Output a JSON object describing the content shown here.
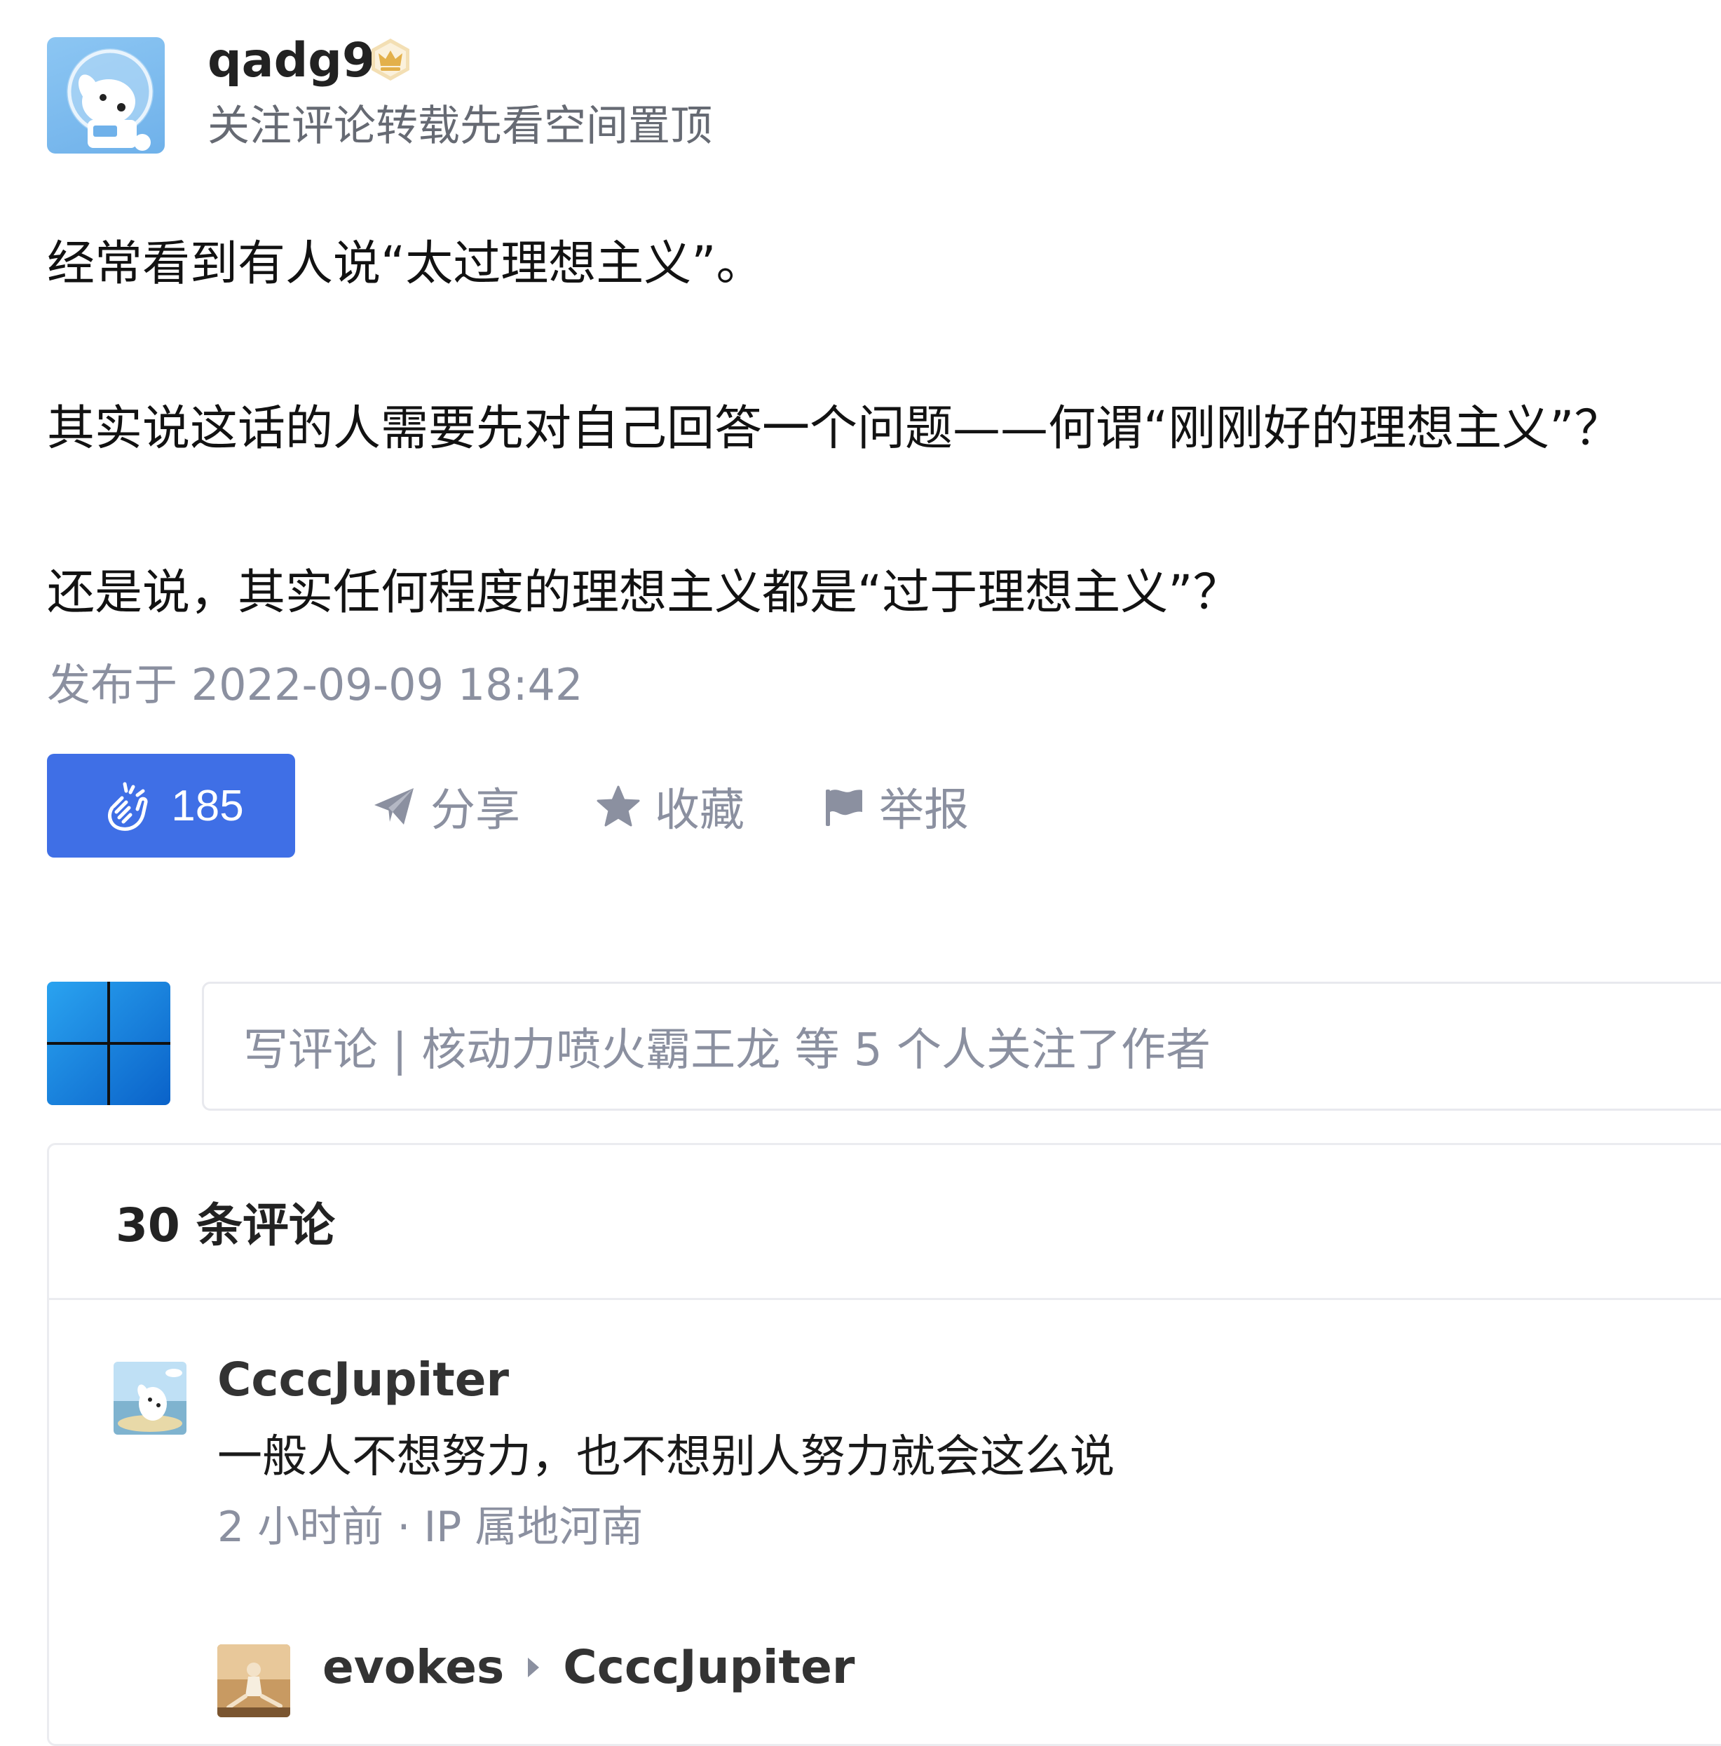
{
  "author": {
    "name": "qadg9",
    "badge_icon": "crown-icon",
    "description": "关注评论转载先看空间置顶"
  },
  "post": {
    "paragraphs": [
      "经常看到有人说“太过理想主义”。",
      "其实说这话的人需要先对自己回答一个问题——何谓“刚刚好的理想主义”？",
      "还是说，其实任何程度的理想主义都是“过于理想主义”？"
    ],
    "published": "发布于 2022-09-09 18:42"
  },
  "actions": {
    "clap_count": "185",
    "share_label": "分享",
    "favorite_label": "收藏",
    "report_label": "举报"
  },
  "comment_box": {
    "placeholder": "写评论 | 核动力喷火霸王龙 等 5 个人关注了作者"
  },
  "comments": {
    "count_label": "30 条评论",
    "items": [
      {
        "user": "CcccJupiter",
        "text": "一般人不想努力，也不想别人努力就会这么说",
        "meta": "2 小时前 · IP 属地河南"
      }
    ],
    "reply": {
      "user": "evokes",
      "reply_to": "CcccJupiter"
    }
  },
  "colors": {
    "accent": "#3f6fe6",
    "muted_text": "#8b90a0",
    "badge_gold": "#e3b04b"
  }
}
